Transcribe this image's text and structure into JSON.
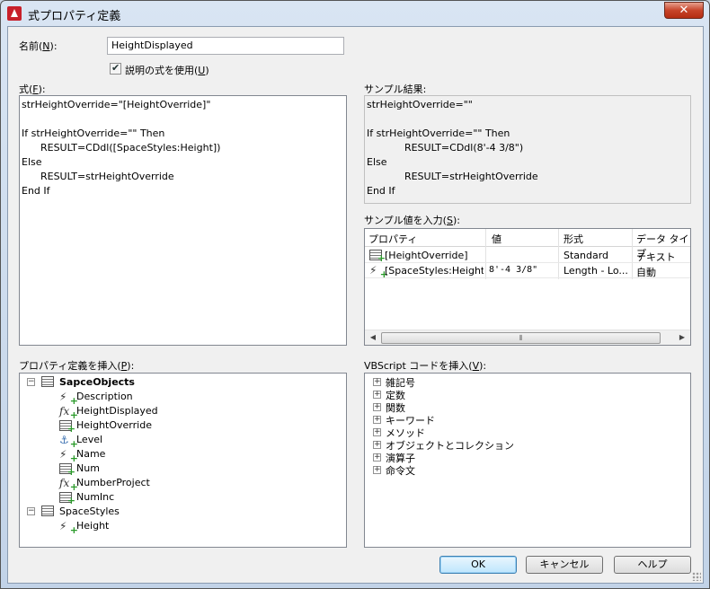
{
  "window": {
    "title": "式プロパティ定義",
    "close_label": "✕"
  },
  "name_field": {
    "label": "名前(",
    "hotkey": "N",
    "label_suffix": "):",
    "value": "HeightDisplayed"
  },
  "use_description": {
    "label": "説明の式を使用(",
    "hotkey": "U",
    "label_suffix": ")",
    "checked": true
  },
  "formula": {
    "label": "式(",
    "hotkey": "F",
    "label_suffix": "):",
    "lines": [
      "strHeightOverride=\"[HeightOverride]\"",
      "",
      "If strHeightOverride=\"\" Then",
      "      RESULT=CDdl([SpaceStyles:Height])",
      "Else",
      "      RESULT=strHeightOverride",
      "End If"
    ]
  },
  "sample_result": {
    "label": "サンプル結果:",
    "lines": [
      "strHeightOverride=\"\"",
      "",
      "If strHeightOverride=\"\" Then",
      "            RESULT=CDdl(8'-4 3/8\")",
      "Else",
      "            RESULT=strHeightOverride",
      "End If"
    ]
  },
  "sample_values": {
    "label": "サンプル値を入力(",
    "hotkey": "S",
    "label_suffix": "):",
    "columns": [
      "プロパティ",
      "値",
      "形式",
      "データ タイプ"
    ],
    "rows": [
      {
        "icon": "table-property-icon",
        "property": "[HeightOverride]",
        "value": "",
        "format": "Standard",
        "type": "テキスト"
      },
      {
        "icon": "automatic-property-icon",
        "property": "[SpaceStyles:Height]",
        "value": "8'-4 3/8\"",
        "format": "Length - Lo...",
        "type": "自動"
      }
    ]
  },
  "insert_property": {
    "label": "プロパティ定義を挿入(",
    "hotkey": "P",
    "label_suffix": "):",
    "groups": [
      {
        "name": "SapceObjects",
        "bold": true,
        "expanded": true,
        "items": [
          {
            "icon": "automatic-property-icon",
            "label": "Description"
          },
          {
            "icon": "formula-property-icon",
            "label": "HeightDisplayed"
          },
          {
            "icon": "table-property-icon",
            "label": "HeightOverride"
          },
          {
            "icon": "location-property-icon",
            "label": "Level"
          },
          {
            "icon": "automatic-property-icon",
            "label": "Name"
          },
          {
            "icon": "table-property-icon",
            "label": "Num"
          },
          {
            "icon": "formula-property-icon",
            "label": "NumberProject"
          },
          {
            "icon": "table-property-icon",
            "label": "NumInc"
          }
        ]
      },
      {
        "name": "SpaceStyles",
        "bold": false,
        "expanded": true,
        "items": [
          {
            "icon": "automatic-property-icon",
            "label": "Height"
          }
        ]
      }
    ]
  },
  "insert_vbscript": {
    "label": "VBScript コードを挿入(",
    "hotkey": "V",
    "label_suffix": "):",
    "items": [
      "雑記号",
      "定数",
      "関数",
      "キーワード",
      "メソッド",
      "オブジェクトとコレクション",
      "演算子",
      "命令文"
    ]
  },
  "buttons": {
    "ok": "OK",
    "cancel": "キャンセル",
    "help": "ヘルプ"
  }
}
